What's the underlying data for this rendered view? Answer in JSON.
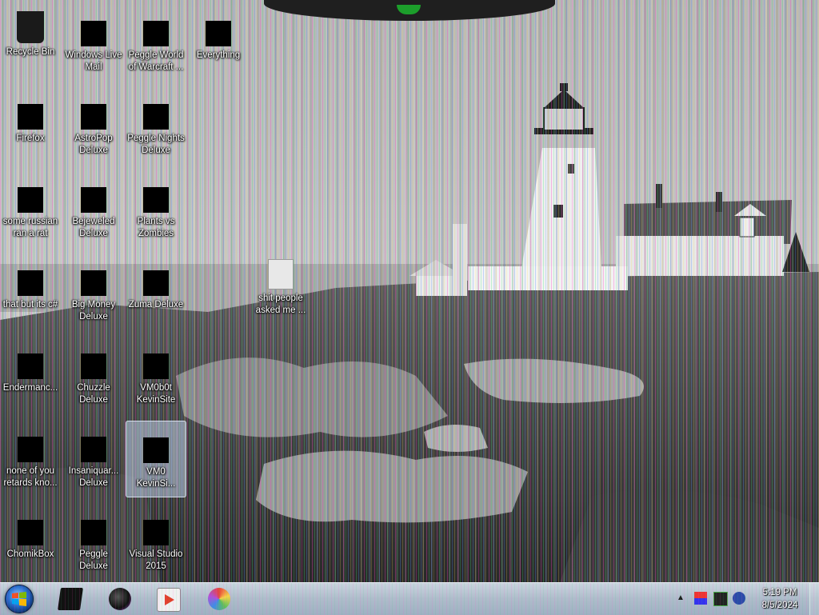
{
  "desktop": {
    "icons": [
      {
        "label": "Recycle Bin",
        "icon": "recycle-bin-icon"
      },
      {
        "label": "Windows Live\nMail",
        "icon": "mail-icon"
      },
      {
        "label": "Peggle World\nof Warcraft ...",
        "icon": "game-icon"
      },
      {
        "label": "Everything",
        "icon": "search-app-icon"
      },
      {
        "label": "Firefox",
        "icon": "firefox-icon"
      },
      {
        "label": "AstroPop\nDeluxe",
        "icon": "game-icon"
      },
      {
        "label": "Peggle Nights\nDeluxe",
        "icon": "game-icon"
      },
      {
        "label": "some russian\nran a rat",
        "icon": "executable-icon"
      },
      {
        "label": "Bejeweled\nDeluxe",
        "icon": "game-icon"
      },
      {
        "label": "Plants vs\nZombies",
        "icon": "game-icon"
      },
      {
        "label": "that but its c#",
        "icon": "executable-icon"
      },
      {
        "label": "Big Money\nDeluxe",
        "icon": "game-icon"
      },
      {
        "label": "Zuma Deluxe",
        "icon": "game-icon"
      },
      {
        "label": "shit people\nasked me ...",
        "icon": "folder-icon"
      },
      {
        "label": "Endermanc...",
        "icon": "executable-icon"
      },
      {
        "label": "Chuzzle\nDeluxe",
        "icon": "game-icon"
      },
      {
        "label": "VM0b0t\nKevinSite",
        "icon": "executable-icon"
      },
      {
        "label": "none of you\nretards kno...",
        "icon": "executable-icon"
      },
      {
        "label": "Insaniquar...\nDeluxe",
        "icon": "game-icon"
      },
      {
        "label": "VM0\nKevinSi...",
        "icon": "executable-icon"
      },
      {
        "label": "ChomikBox",
        "icon": "chomikbox-icon"
      },
      {
        "label": "Peggle Deluxe",
        "icon": "game-icon"
      },
      {
        "label": "Visual Studio\n2015",
        "icon": "visual-studio-icon"
      }
    ]
  },
  "taskbar": {
    "start": "start-orb-icon",
    "pinned": [
      "file-manager-icon",
      "media-player-icon",
      "video-player-icon",
      "browser-icon"
    ],
    "tray": [
      "show-hidden-icons-icon",
      "flag-icon",
      "network-icon",
      "volume-icon"
    ]
  },
  "clock": {
    "time": "5:19 PM",
    "date": "8/5/2024"
  },
  "colors": {
    "taskbar": "#aebccb",
    "accent_green": "#1c9e2b",
    "selection": "#becde6"
  }
}
